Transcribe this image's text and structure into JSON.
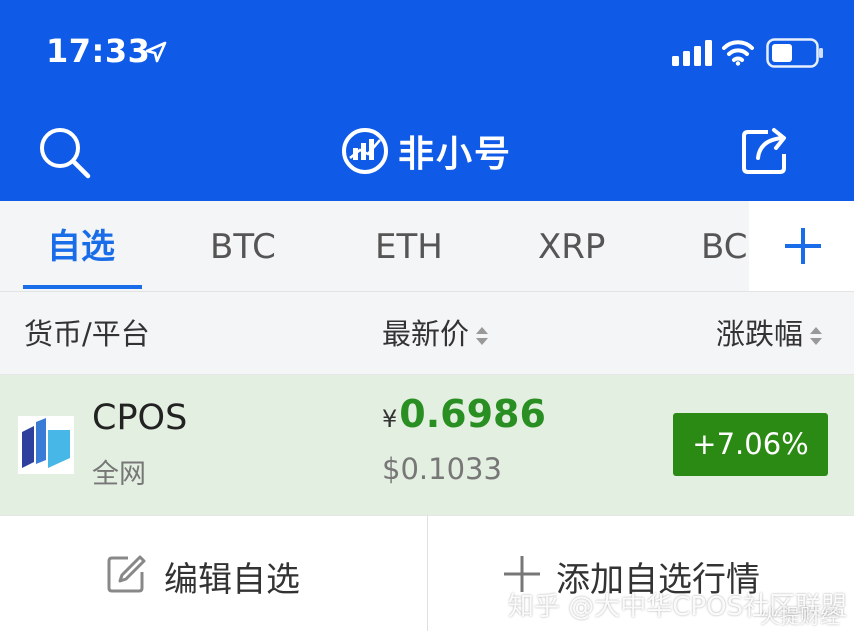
{
  "status_bar": {
    "time": "17:33",
    "icons": [
      "location-arrow-icon",
      "signal-icon",
      "wifi-icon",
      "battery-icon"
    ]
  },
  "header": {
    "brand": "非小号",
    "left_icon": "search-icon",
    "right_icon": "share-icon",
    "bg_color": "#0f5be8"
  },
  "tabs": [
    {
      "label": "自选",
      "active": true
    },
    {
      "label": "BTC"
    },
    {
      "label": "ETH"
    },
    {
      "label": "XRP"
    },
    {
      "label": "BC"
    }
  ],
  "columns": {
    "coin": "货币/平台",
    "price": "最新价",
    "change": "涨跌幅"
  },
  "rows": [
    {
      "name": "CPOS",
      "platform": "全网",
      "currency_symbol": "¥",
      "price_cny": "0.6986",
      "price_usd": "$0.1033",
      "change": "+7.06%",
      "change_color": "#2b8a13"
    }
  ],
  "bottom": {
    "edit_label": "编辑自选",
    "add_label": "添加自选行情"
  },
  "watermark": {
    "text": "知乎 @大中华CPOS社区联盟",
    "text2": "火提财经"
  }
}
